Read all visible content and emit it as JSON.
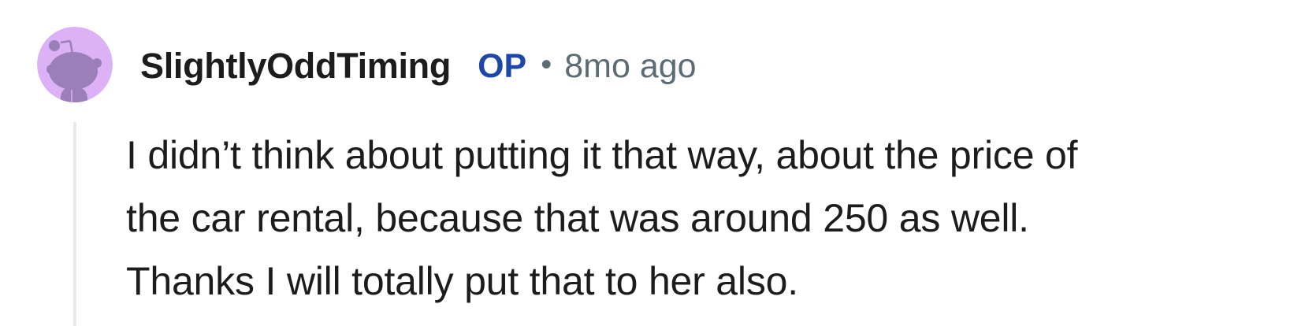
{
  "comment": {
    "author": "SlightlyOddTiming",
    "op_badge": "OP",
    "separator": "•",
    "timestamp": "8mo ago",
    "avatar_icon": "reddit-snoo-avatar-icon",
    "body_lines": [
      "I didn’t think about putting it that way, about the price of",
      "the car rental, because that was around 250 as well.",
      "Thanks I will totally put that to her also."
    ]
  },
  "colors": {
    "avatar_bg": "#dcb1f5",
    "avatar_figure": "#9a7fb8",
    "op_badge": "#1f47a8",
    "meta_text": "#5c6c74",
    "body_text": "#1c1c1c",
    "thread_line": "#e5ebee"
  }
}
